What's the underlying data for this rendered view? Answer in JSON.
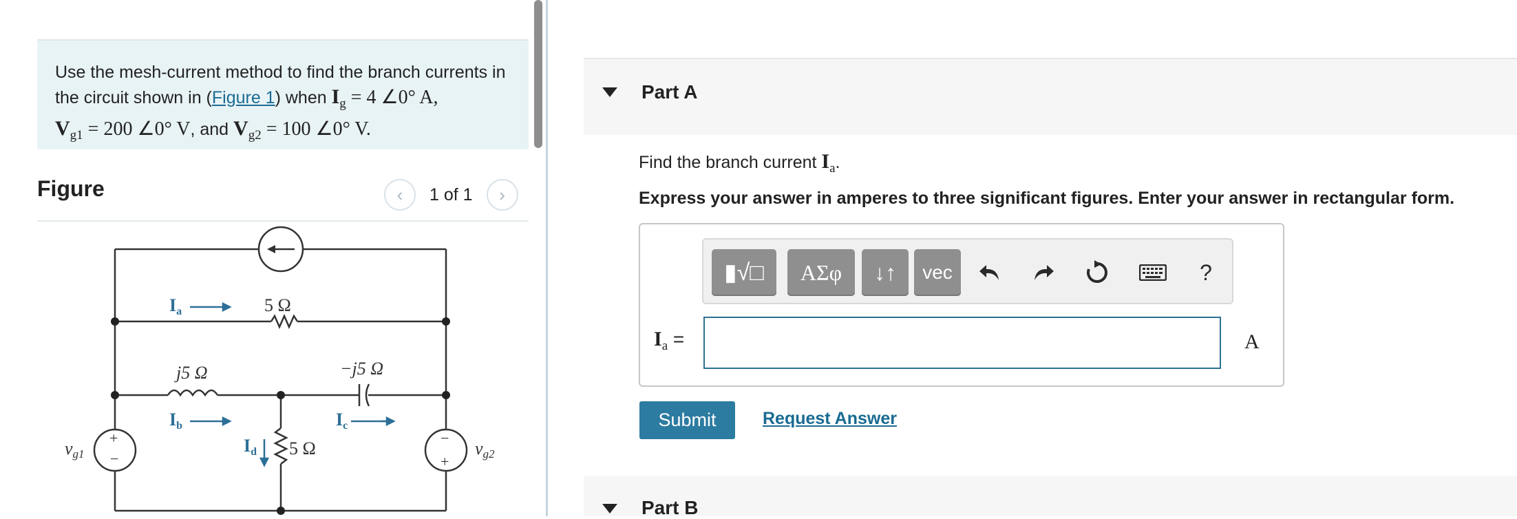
{
  "problem": {
    "text_a": "Use the mesh-current method to find the branch currents in the circuit shown in (",
    "link": "Figure 1",
    "text_b": ") when ",
    "ig_sym": "I",
    "ig_sub": "g",
    "ig_val": " = 4 ∠0° A,",
    "vg1_sym": "V",
    "vg1_sub": "g1",
    "vg1_val": " = 200 ∠0° V",
    "and_text": ", and ",
    "vg2_sym": "V",
    "vg2_sub": "g2",
    "vg2_val": " = 100 ∠0° V."
  },
  "figure": {
    "title": "Figure",
    "page": "1 of 1",
    "prev_icon": "chevron-left-icon",
    "next_icon": "chevron-right-icon",
    "labels": {
      "ia": "I",
      "ia_sub": "a",
      "ib": "I",
      "ib_sub": "b",
      "ic": "I",
      "ic_sub": "c",
      "id": "I",
      "id_sub": "d",
      "r_top": "5 Ω",
      "l_left": "j5 Ω",
      "c_right": "−j5 Ω",
      "r_mid": "5 Ω",
      "vg1": "v",
      "vg1_sub": "g1",
      "vg2": "v",
      "vg2_sub": "g2",
      "plus": "+",
      "minus": "−"
    }
  },
  "partA": {
    "label": "Part A",
    "question_a": "Find the branch current ",
    "question_sym": "I",
    "question_sub": "a",
    "question_end": ".",
    "instruction": "Express your answer in amperes to three significant figures. Enter your answer in rectangular form.",
    "toolbar": {
      "templates_icon": "▮√□",
      "greek": "ΑΣφ",
      "arrows": "↓↑",
      "vec": "vec",
      "undo_icon": "undo-icon",
      "redo_icon": "redo-icon",
      "reset_icon": "reset-icon",
      "keyboard_icon": "keyboard-icon",
      "help": "?"
    },
    "answer_sym": "I",
    "answer_sub": "a",
    "answer_eq": " =",
    "answer_value": "",
    "unit": "A",
    "submit": "Submit",
    "request": "Request Answer"
  },
  "partB": {
    "label": "Part B"
  }
}
